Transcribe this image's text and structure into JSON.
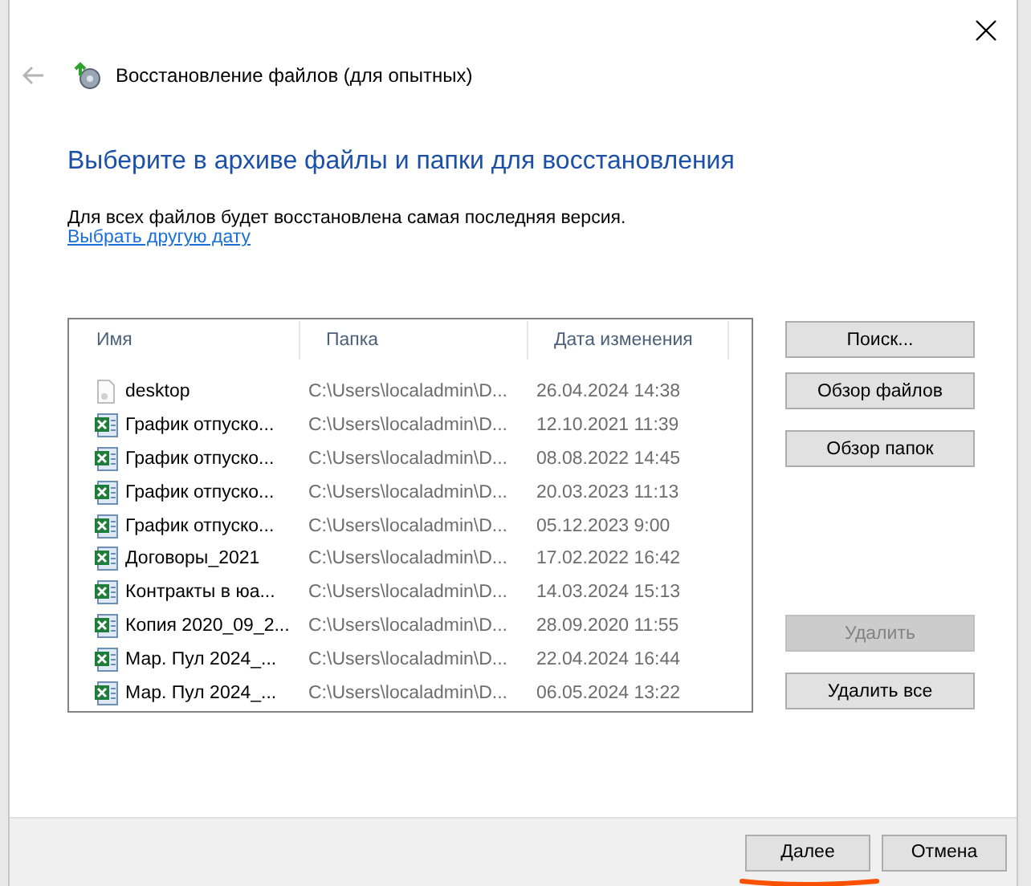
{
  "window": {
    "title": "Восстановление файлов (для опытных)"
  },
  "heading": "Выберите в архиве файлы и папки для восстановления",
  "description": "Для всех файлов будет восстановлена самая последняя версия.",
  "link": "Выбрать другую дату",
  "table": {
    "columns": [
      "Имя",
      "Папка",
      "Дата изменения"
    ],
    "rows": [
      {
        "kind": "file",
        "name": "desktop",
        "folder": "C:\\Users\\localadmin\\D...",
        "date": "26.04.2024 14:38"
      },
      {
        "kind": "excel",
        "name": "График отпуско...",
        "folder": "C:\\Users\\localadmin\\D...",
        "date": "12.10.2021 11:39"
      },
      {
        "kind": "excel",
        "name": "График отпуско...",
        "folder": "C:\\Users\\localadmin\\D...",
        "date": "08.08.2022 14:45"
      },
      {
        "kind": "excel",
        "name": "График отпуско...",
        "folder": "C:\\Users\\localadmin\\D...",
        "date": "20.03.2023 11:13"
      },
      {
        "kind": "excel",
        "name": "График отпуско...",
        "folder": "C:\\Users\\localadmin\\D...",
        "date": "05.12.2023 9:00"
      },
      {
        "kind": "excel",
        "name": "Договоры_2021",
        "folder": "C:\\Users\\localadmin\\D...",
        "date": "17.02.2022 16:42"
      },
      {
        "kind": "excel",
        "name": "Контракты в юа...",
        "folder": "C:\\Users\\localadmin\\D...",
        "date": "14.03.2024 15:13"
      },
      {
        "kind": "excel",
        "name": "Копия 2020_09_2...",
        "folder": "C:\\Users\\localadmin\\D...",
        "date": "28.09.2020 11:55"
      },
      {
        "kind": "excel",
        "name": "Мар. Пул 2024_...",
        "folder": "C:\\Users\\localadmin\\D...",
        "date": "22.04.2024 16:44"
      },
      {
        "kind": "excel",
        "name": "Мар. Пул 2024_...",
        "folder": "C:\\Users\\localadmin\\D...",
        "date": "06.05.2024 13:22"
      }
    ]
  },
  "side_buttons_top": [
    {
      "label": "Поиск...",
      "disabled": false
    },
    {
      "label": "Обзор файлов",
      "disabled": false
    },
    {
      "label": "Обзор папок",
      "disabled": false
    }
  ],
  "side_buttons_bottom": [
    {
      "label": "Удалить",
      "disabled": true
    },
    {
      "label": "Удалить все",
      "disabled": false
    }
  ],
  "footer_buttons": [
    {
      "label": "Далее",
      "underlined": true
    },
    {
      "label": "Отмена",
      "underlined": false
    }
  ]
}
